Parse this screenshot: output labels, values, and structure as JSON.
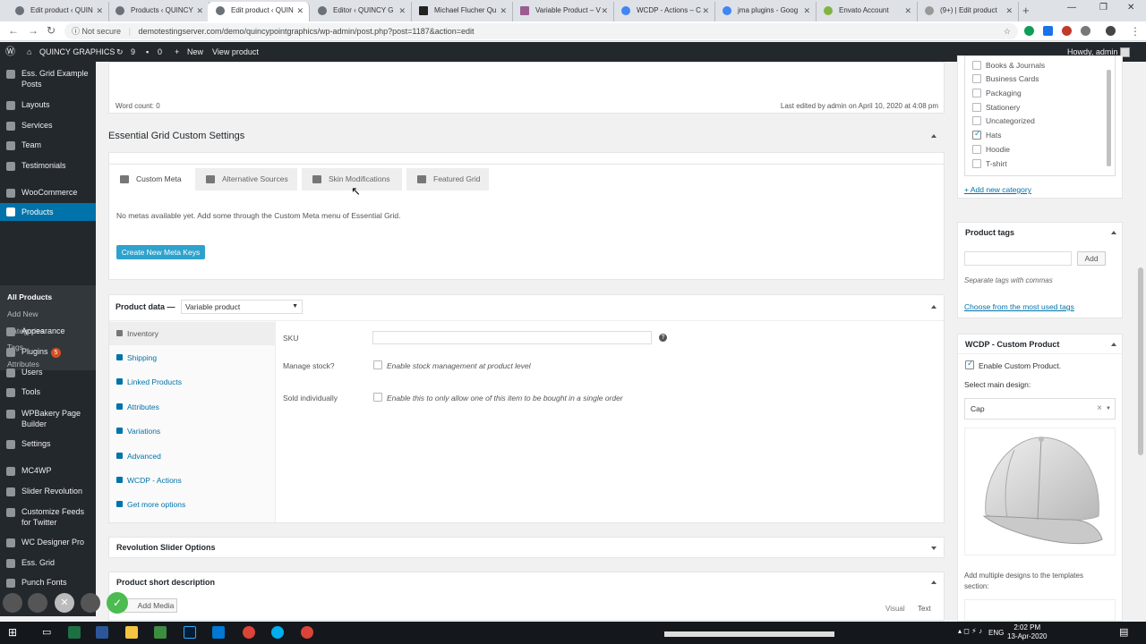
{
  "browser": {
    "tabs": [
      {
        "label": "Edit product ‹ QUIN"
      },
      {
        "label": "Products ‹ QUINCY"
      },
      {
        "label": "Edit product ‹ QUIN"
      },
      {
        "label": "Editor ‹ QUINCY G"
      },
      {
        "label": "Michael Flucher Qu"
      },
      {
        "label": "Variable Product – V"
      },
      {
        "label": "WCDP - Actions – C"
      },
      {
        "label": "jma plugins - Goog"
      },
      {
        "label": "Envato Account"
      },
      {
        "label": "(9+) | Edit product"
      }
    ],
    "not_secure": "Not secure",
    "url": "demotestingserver.com/demo/quincypointgraphics/wp-admin/post.php?post=1187&action=edit"
  },
  "adminbar": {
    "site": "QUINCY GRAPHICS",
    "updates": "9",
    "comments": "0",
    "new": "New",
    "view": "View product",
    "howdy": "Howdy, admin"
  },
  "sidebar": {
    "items": [
      {
        "label": "Ess. Grid Example"
      },
      {
        "label": "Posts"
      },
      {
        "label": "Layouts"
      },
      {
        "label": "Services"
      },
      {
        "label": "Team"
      },
      {
        "label": "Testimonials"
      },
      {
        "label": "WooCommerce"
      },
      {
        "label": "Products"
      },
      {
        "label": "Appearance"
      },
      {
        "label": "Plugins",
        "badge": "5"
      },
      {
        "label": "Users"
      },
      {
        "label": "Tools"
      },
      {
        "label": "WPBakery Page"
      },
      {
        "label": "Builder"
      },
      {
        "label": "Settings"
      },
      {
        "label": "MC4WP"
      },
      {
        "label": "Slider Revolution"
      },
      {
        "label": "Customize Feeds"
      },
      {
        "label": "for Twitter"
      },
      {
        "label": "WC Designer Pro"
      },
      {
        "label": "Ess. Grid"
      },
      {
        "label": "Punch Fonts"
      }
    ],
    "submenu": [
      "All Products",
      "Add New",
      "Categories",
      "Tags",
      "Attributes"
    ]
  },
  "editor": {
    "word_count": "Word count: 0",
    "last_edited": "Last edited by admin on April 10, 2020 at 4:08 pm"
  },
  "ess_grid": {
    "title": "Essential Grid Custom Settings",
    "tabs": [
      "Custom Meta",
      "Alternative Sources",
      "Skin Modifications",
      "Featured Grid"
    ],
    "notice": "No metas available yet. Add some through the Custom Meta menu of Essential Grid.",
    "button": "Create New Meta Keys"
  },
  "product_data": {
    "label": "Product data —",
    "type": "Variable product",
    "tabs": [
      "Inventory",
      "Shipping",
      "Linked Products",
      "Attributes",
      "Variations",
      "Advanced",
      "WCDP - Actions",
      "Get more options"
    ],
    "sku_label": "SKU",
    "manage_label": "Manage stock?",
    "manage_text": "Enable stock management at product level",
    "sold_label": "Sold individually",
    "sold_text": "Enable this to only allow one of this item to be bought in a single order",
    "help": "?"
  },
  "rev_slider": {
    "title": "Revolution Slider Options"
  },
  "short_desc": {
    "title": "Product short description",
    "add_media": "Add Media",
    "visual": "Visual",
    "text": "Text"
  },
  "categories": {
    "items": [
      {
        "label": "Books & Journals",
        "checked": false
      },
      {
        "label": "Business Cards",
        "checked": false
      },
      {
        "label": "Packaging",
        "checked": false
      },
      {
        "label": "Stationery",
        "checked": false
      },
      {
        "label": "Uncategorized",
        "checked": false
      },
      {
        "label": "Hats",
        "checked": true
      },
      {
        "label": "Hoodie",
        "checked": false
      },
      {
        "label": "T-shirt",
        "checked": false
      }
    ],
    "add_new": "+ Add new category"
  },
  "tags": {
    "title": "Product tags",
    "add": "Add",
    "hint": "Separate tags with commas",
    "choose": "Choose from the most used tags"
  },
  "wcdp": {
    "title": "WCDP - Custom Product",
    "enable": "Enable Custom Product.",
    "select_label": "Select main design:",
    "design": "Cap",
    "clear": "×",
    "note": "Add multiple designs to the templates section:"
  },
  "taskbar": {
    "time": "2:02 PM",
    "date": "13-Apr-2020",
    "lang": "ENG"
  }
}
